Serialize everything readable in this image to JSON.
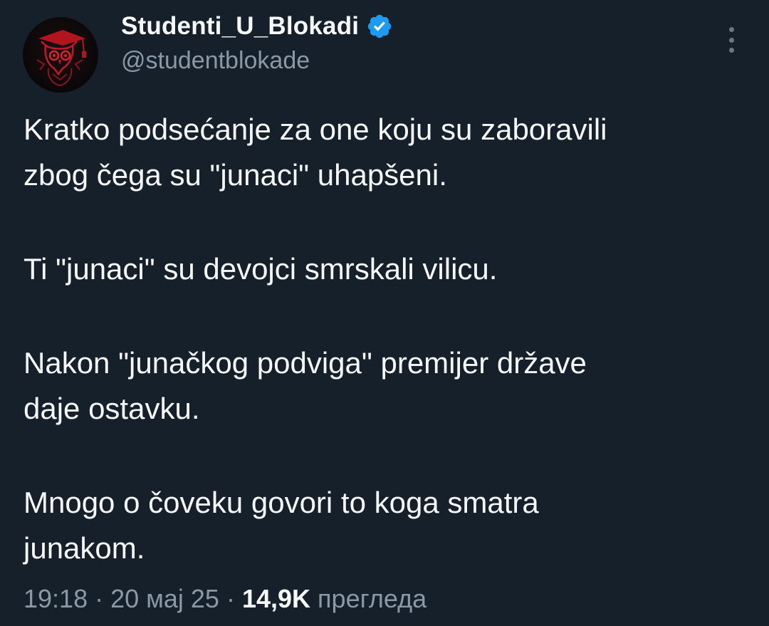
{
  "author": {
    "display_name": "Studenti_U_Blokadi",
    "handle": "@studentblokade",
    "verified": true,
    "avatar_icon": "owl-graduation-cap-icon",
    "verified_icon": "verified-badge-icon",
    "verified_color": "#1d9bf0"
  },
  "tweet": {
    "paragraphs": [
      "Kratko podsećanje za one koju su zaboravili\nzbog čega su \"junaci\" uhapšeni.",
      "Ti \"junaci\" su devojci smrskali vilicu.",
      "Nakon \"junačkog podviga\" premijer države\ndaje ostavku.",
      "Mnogo o čoveku govori to koga smatra\njunakom."
    ]
  },
  "meta": {
    "time": "19:18",
    "separator": "·",
    "date": "20 мај 25",
    "views_count": "14,9K",
    "views_label": "прегледа"
  },
  "colors": {
    "background": "#15202b",
    "text_primary": "#f7f9f9",
    "text_secondary": "#8b98a5"
  },
  "icons": {
    "more": "more-vertical-icon"
  }
}
